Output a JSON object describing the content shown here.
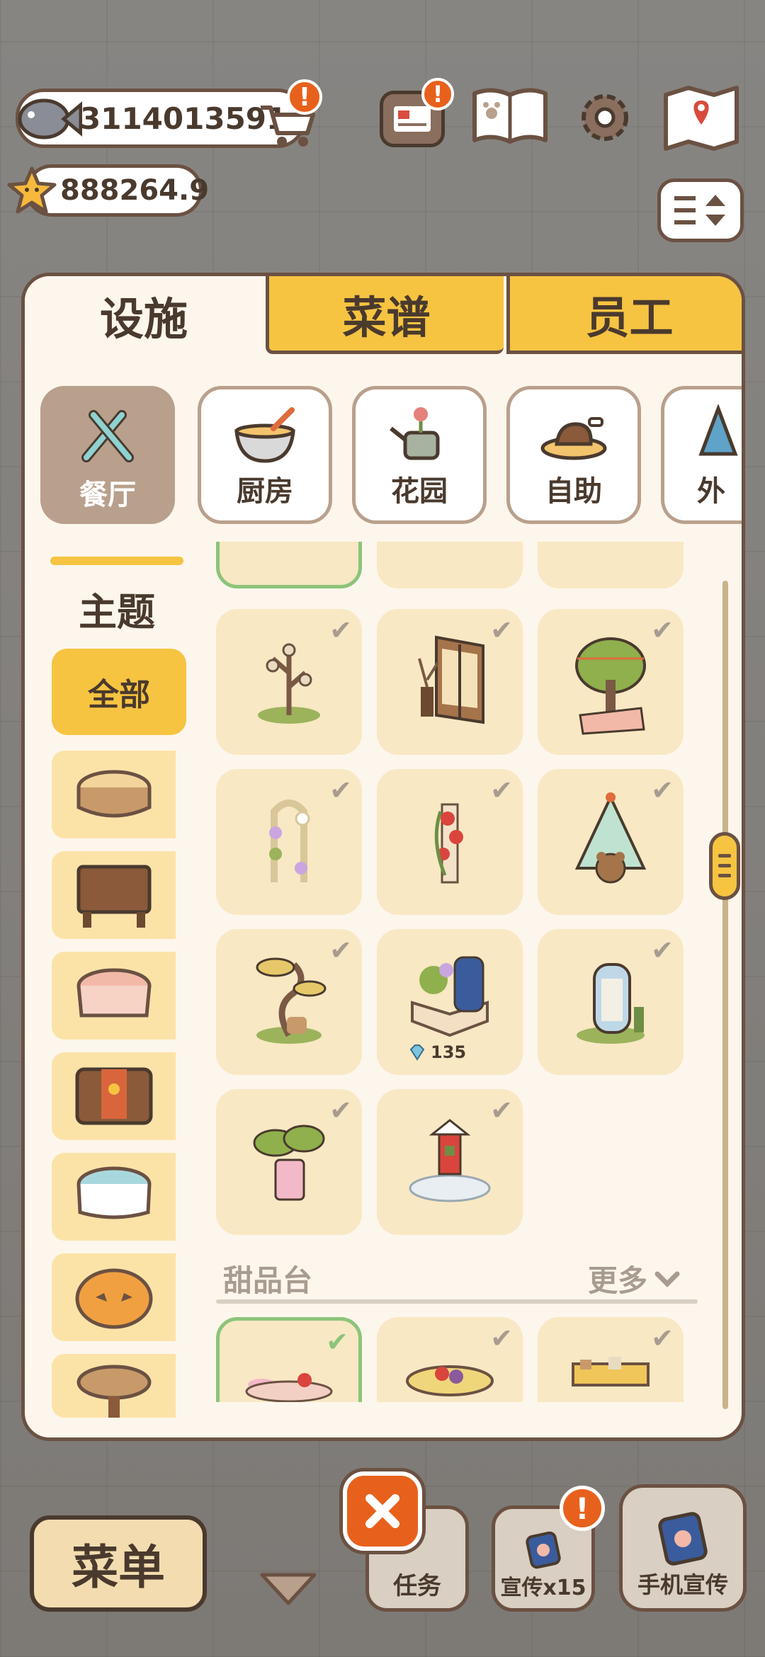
{
  "currency": {
    "fish_amount": "3114013591",
    "star_amount": "888264.9"
  },
  "alert_mark": "!",
  "tabs": [
    {
      "label": "设施"
    },
    {
      "label": "菜谱"
    },
    {
      "label": "员工"
    }
  ],
  "categories": [
    {
      "label": "餐厅"
    },
    {
      "label": "厨房"
    },
    {
      "label": "花园"
    },
    {
      "label": "自助"
    },
    {
      "label": "外"
    }
  ],
  "sidebar": {
    "title": "主题",
    "all_label": "全部"
  },
  "grid": {
    "price": "135"
  },
  "section": {
    "title": "甜品台",
    "more_label": "更多"
  },
  "bottom": {
    "menu_label": "菜单",
    "task_label": "任务",
    "promo_label": "宣传x15",
    "phone_promo_label": "手机宣传"
  },
  "colors": {
    "panel_bg": "#fdf6ec",
    "border": "#6b5142",
    "tab_yellow": "#f6c441",
    "selected_cat": "#b9a08c",
    "card_bg": "#f8e8c4",
    "close_orange": "#e8611c",
    "check_green": "#8cc47a"
  }
}
